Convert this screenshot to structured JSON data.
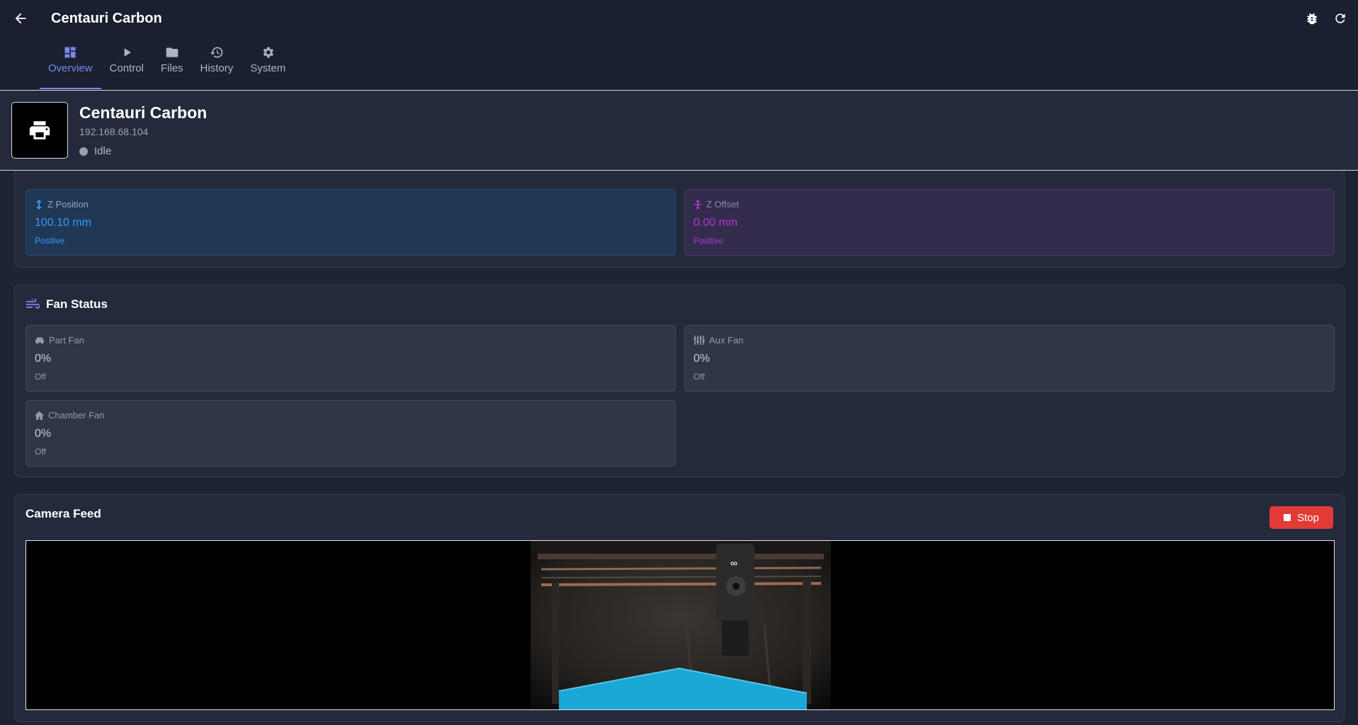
{
  "app": {
    "title": "Centauri Carbon"
  },
  "tabs": [
    {
      "label": "Overview",
      "icon": "dashboard-icon",
      "active": true
    },
    {
      "label": "Control",
      "icon": "play-icon"
    },
    {
      "label": "Files",
      "icon": "folder-icon"
    },
    {
      "label": "History",
      "icon": "history-icon"
    },
    {
      "label": "System",
      "icon": "gear-icon"
    }
  ],
  "printer": {
    "name": "Centauri Carbon",
    "ip": "192.168.68.104",
    "status": "Idle",
    "icon": "printer-icon"
  },
  "position": {
    "z_position": {
      "label": "Z Position",
      "value": "100.10 mm",
      "sub": "Positive",
      "icon": "vertical-arrows-icon"
    },
    "z_offset": {
      "label": "Z Offset",
      "value": "0.00 mm",
      "sub": "Positive",
      "icon": "offset-icon"
    }
  },
  "fans": {
    "title": "Fan Status",
    "icon": "wind-icon",
    "part": {
      "label": "Part Fan",
      "value": "0%",
      "sub": "Off",
      "icon": "car-fan-icon"
    },
    "aux": {
      "label": "Aux Fan",
      "value": "0%",
      "sub": "Off",
      "icon": "sliders-icon"
    },
    "chamber": {
      "label": "Chamber Fan",
      "value": "0%",
      "sub": "Off",
      "icon": "home-icon"
    }
  },
  "camera": {
    "title": "Camera Feed",
    "stop_label": "Stop"
  },
  "colors": {
    "accent": "#7a88e8",
    "z_position": "#2f9bff",
    "z_offset": "#b536d6",
    "stop": "#e23a36"
  }
}
